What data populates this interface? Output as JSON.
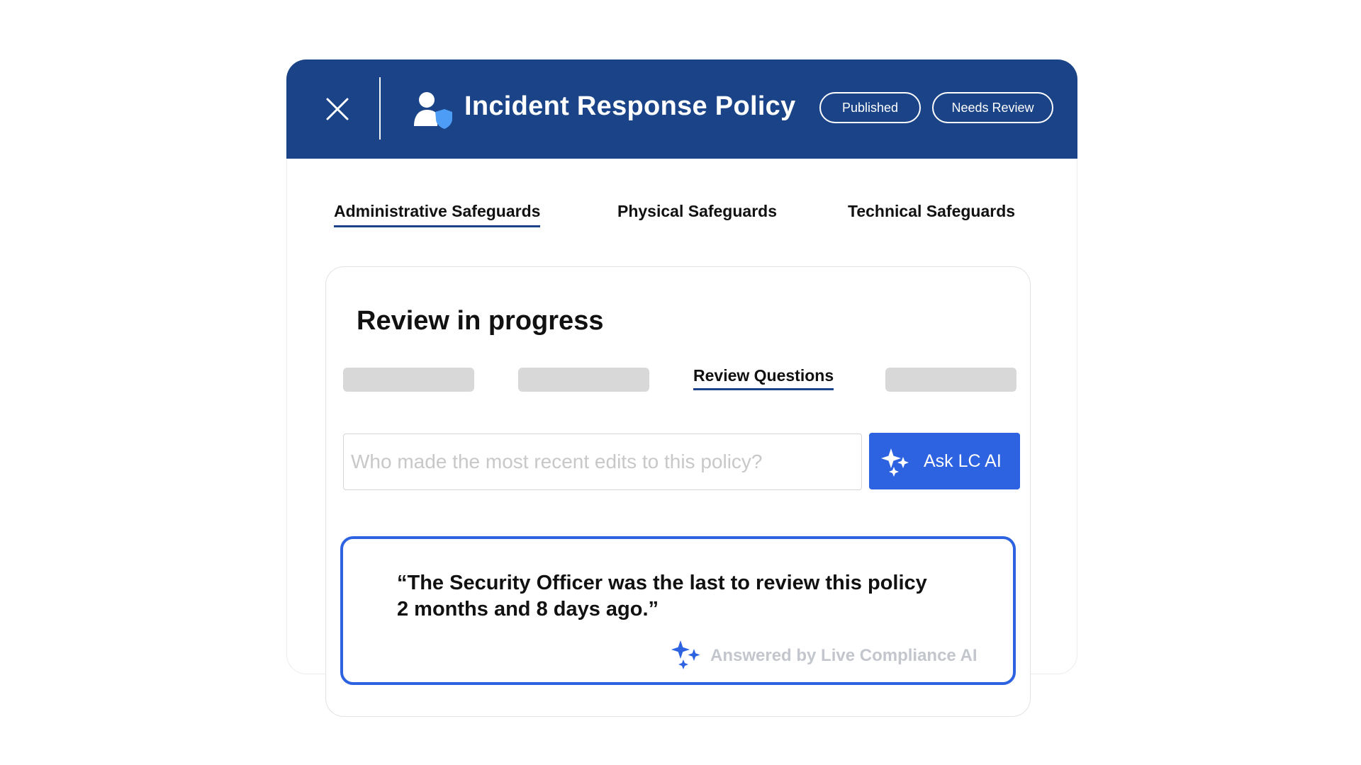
{
  "header": {
    "title": "Incident Response Policy",
    "badges": [
      "Published",
      "Needs Review"
    ],
    "background_color": "#1a4487",
    "icons": {
      "close": "close-icon",
      "policy": "user-shield-icon"
    }
  },
  "tabs": [
    {
      "label": "Administrative Safeguards",
      "active": true
    },
    {
      "label": "Physical Safeguards",
      "active": false
    },
    {
      "label": "Technical Safeguards",
      "active": false
    }
  ],
  "review": {
    "title": "Review in progress",
    "sub_tabs": [
      {
        "label": "",
        "placeholder": true
      },
      {
        "label": "",
        "placeholder": true
      },
      {
        "label": "Review Questions",
        "active": true
      },
      {
        "label": "",
        "placeholder": true
      }
    ],
    "search": {
      "placeholder": "Who made the most recent edits to this policy?",
      "value": ""
    },
    "ask_button": {
      "label": "Ask LC AI",
      "icon": "sparkle-icon",
      "color": "#2d62e0"
    },
    "answer": {
      "line1": "“The Security Officer was the last to review this policy",
      "line2": "2 months and 8 days ago.”",
      "attribution": "Answered by Live Compliance AI",
      "attribution_icon": "sparkle-icon"
    }
  }
}
